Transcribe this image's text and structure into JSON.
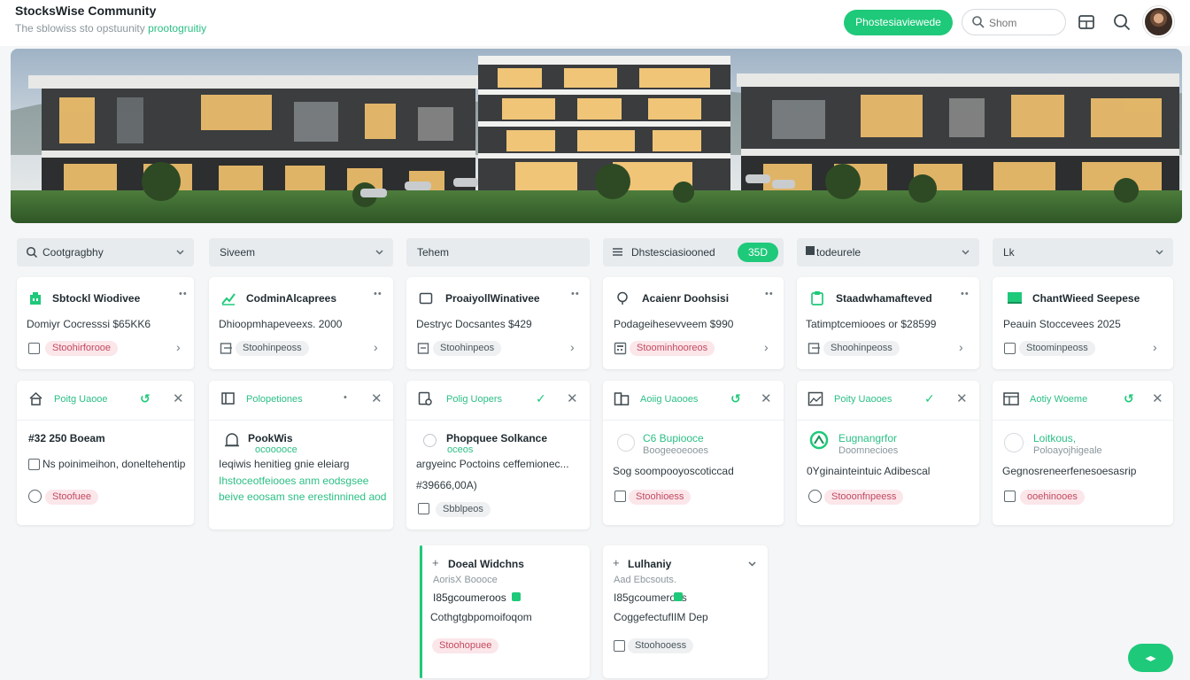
{
  "header": {
    "brand_title": "StocksWise Community",
    "brand_sub_prefix": "The sblowiss sto opstuunity ",
    "brand_sub_accent": "prootogruitiy",
    "cta_label": "Phostesiaviewede",
    "search_placeholder": "Shom"
  },
  "filters": [
    {
      "label": "Cootgragbhy"
    },
    {
      "label": "Siveem"
    },
    {
      "label": "Tehem"
    },
    {
      "label": "Dhstesciasiooned",
      "badge": "35D"
    },
    {
      "label": "todeurele"
    },
    {
      "label": "Lk"
    }
  ],
  "row1": [
    {
      "title": "Sbtockl Wiodivee",
      "sub": "Domiyr Cocresssi $65KK6",
      "tag": "Stoohirforooe"
    },
    {
      "title": "CodminAlcaprees",
      "sub": "Dhioopmhapeveexs. 2000",
      "tag": "Stoohinpeoss"
    },
    {
      "title": "ProaiyollWinativee",
      "sub": "Destryc Docsantes $429",
      "tag": "Stoohinpeos"
    },
    {
      "title": "Acaienr Doohsisi",
      "sub": "Podageihesevveem $990",
      "tag": "Stoominhooreos"
    },
    {
      "title": "Staadwhamafteved",
      "sub": "Tatimptcemiooes or $28599",
      "tag": "Shoohinpeoss"
    },
    {
      "title": "ChantWieed Seepese",
      "sub": "Peauin Stoccevees 2025",
      "tag": "Stoominpeoss"
    }
  ],
  "row2": [
    {
      "head": "Poitg Uaooe",
      "main": "#32 250 Boeam",
      "line2": "Ns poinimeihon, doneltehentip",
      "tag": "Stoofuee"
    },
    {
      "head": "Polopetiones",
      "main": "PookWis",
      "small": "ocooooce",
      "line2": "Ieqiwis henitieg gnie eleiarg",
      "line3": "Ihstoceotfeiooes anm eodsgsee",
      "line4": "beive eoosam sne erestinnined aod"
    },
    {
      "head": "Polig Uopers",
      "main": "Phopquee Solkance",
      "small": "oceos",
      "line2": "argyeinc Poctoins ceffemionec...",
      "line3": "#39666,00A)",
      "tag": "Sbblpeos"
    },
    {
      "head": "Aoiig Uaooes",
      "main": "C6 Bupiooce",
      "small": "Boogeeoeooes",
      "line2": "Sog soompooyoscoticcad",
      "tag": "Stoohioess"
    },
    {
      "head": "Poity Uaooes",
      "main": "Eugnangrfor",
      "small": "Doomnecioes",
      "line2": "0Yginainteintuic Adibescal",
      "tag": "Stooonfnpeess"
    },
    {
      "head": "Aotiy Woeme",
      "main": "Loitkous,",
      "small": "Poloayojhigeale",
      "line2": "Gegnosreneerfenesoesasrip",
      "tag": "ooehinooes"
    }
  ],
  "row3": [
    {
      "title": "Doeal Widchns",
      "small": "AorisX Boooce",
      "green": "I85gcoumeroos",
      "line2": "Cothgtgbpomoifoqom",
      "tag": "Stoohopuee"
    },
    {
      "title": "Lulhaniy",
      "small": "Aad Ebcsouts.",
      "green": "I85gcoumeroos",
      "line2": "CoggefectufIIM Dep",
      "tag": "Stoohooess"
    }
  ],
  "fab_label": "◂▸",
  "colors": {
    "accent": "#1ec97a",
    "tag_pink": "#fbe6ea",
    "tag_text": "#c24a5f",
    "filter_bg": "#e7ebee"
  }
}
